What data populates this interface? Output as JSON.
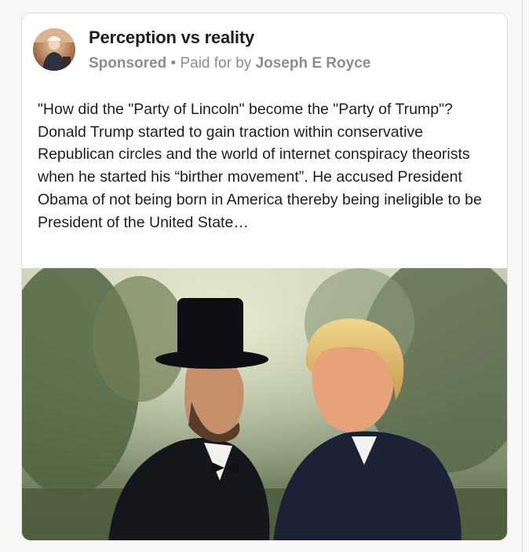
{
  "ad": {
    "page_name": "Perception vs reality",
    "sponsored_label": "Sponsored",
    "separator": " • ",
    "paid_for_label": "Paid for by ",
    "funder_name": "Joseph E Royce",
    "body_text": "\"How did the \"Party of Lincoln\" become the \"Party of Trump\"?\nDonald Trump started to gain traction within conservative Republican circles and the world of internet conspiracy theorists when he started his “birther movement”. He accused President Obama of not being born in America thereby being ineligible to be President of the United State…"
  },
  "colors": {
    "page_name": "#1c1e21",
    "meta": "#8a8d91",
    "card_border": "#dcdde0"
  },
  "icons": {
    "avatar": "profile-photo"
  }
}
